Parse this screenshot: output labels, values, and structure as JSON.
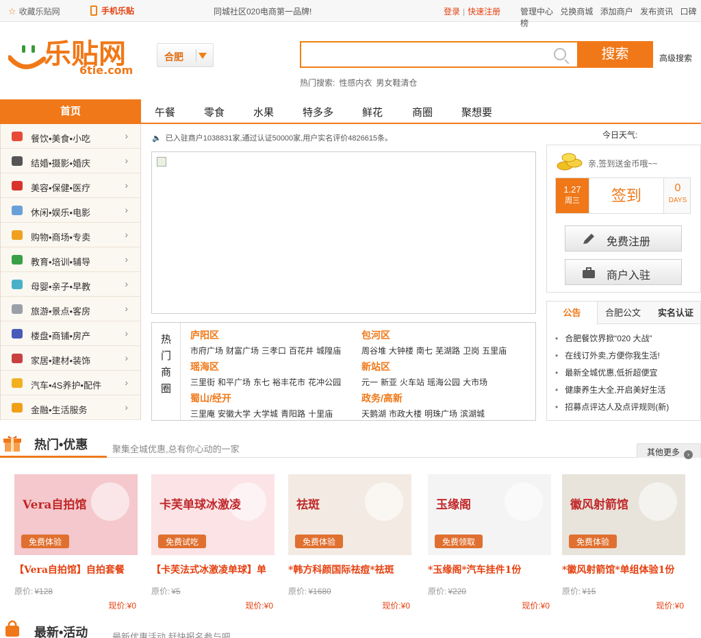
{
  "topbar": {
    "favorite": "收藏乐贴网",
    "mobile": "手机乐贴",
    "slogan": "同城社区020电商第一品牌!",
    "login": "登录",
    "register": "快速注册",
    "links": [
      "管理中心",
      "兑换商城",
      "添加商户",
      "发布资讯",
      "口碑榜"
    ]
  },
  "logo": {
    "text": "乐贴网",
    "domain": "6tie.com"
  },
  "city": "合肥",
  "search": {
    "button": "搜索",
    "advanced": "高级搜索",
    "hot_label": "热门搜索:",
    "hot_terms": [
      "性感内衣",
      "男女鞋清仓"
    ]
  },
  "nav": {
    "home": "首页",
    "items": [
      "午餐",
      "零食",
      "水果",
      "特多多",
      "鲜花",
      "商圈",
      "聚想要"
    ]
  },
  "categories": [
    {
      "label": "餐饮•美食•小吃",
      "icon": "food-icon",
      "color": "#e84a3a"
    },
    {
      "label": "结婚•摄影•婚庆",
      "icon": "camera-icon",
      "color": "#555555"
    },
    {
      "label": "美容•保健•医疗",
      "icon": "beauty-icon",
      "color": "#d8342c"
    },
    {
      "label": "休闲•娱乐•电影",
      "icon": "leisure-icon",
      "color": "#6aa0d8"
    },
    {
      "label": "购物•商场•专卖",
      "icon": "cart-icon",
      "color": "#f0a020"
    },
    {
      "label": "教育•培训•辅导",
      "icon": "book-icon",
      "color": "#3aa048"
    },
    {
      "label": "母婴•亲子•早教",
      "icon": "baby-icon",
      "color": "#4ab0c8"
    },
    {
      "label": "旅游•景点•客房",
      "icon": "plane-icon",
      "color": "#9aa0a8"
    },
    {
      "label": "楼盘•商铺•房产",
      "icon": "building-icon",
      "color": "#4a5ab8"
    },
    {
      "label": "家居•建材•装饰",
      "icon": "tools-icon",
      "color": "#c84040"
    },
    {
      "label": "汽车•4S养护•配件",
      "icon": "car-icon",
      "color": "#f0b020"
    },
    {
      "label": "金融•生活服务",
      "icon": "finance-icon",
      "color": "#f0a018"
    }
  ],
  "notice": "已入驻商户1038831家,通过认证50000家,用户实名评价4826615条。",
  "business": {
    "side": [
      "热",
      "门",
      "商",
      "圈"
    ],
    "groups": [
      {
        "title": "庐阳区",
        "areas": [
          "市府广场",
          "财富广场",
          "三孝口",
          "百花井",
          "城隍庙"
        ]
      },
      {
        "title": "包河区",
        "areas": [
          "周谷堆",
          "大钟楼",
          "南七",
          "芜湖路",
          "卫岗",
          "五里庙"
        ]
      },
      {
        "title": "瑶海区",
        "areas": [
          "三里街",
          "和平广场",
          "东七",
          "裕丰花市",
          "花冲公园"
        ]
      },
      {
        "title": "新站区",
        "areas": [
          "元一",
          "新亚",
          "火车站",
          "瑶海公园",
          "大市场"
        ]
      },
      {
        "title": "蜀山/经开",
        "areas": [
          "三里庵",
          "安徽大学",
          "大学城",
          "青阳路",
          "十里庙"
        ]
      },
      {
        "title": "政务/高新",
        "areas": [
          "天鹅湖",
          "市政大楼",
          "明珠广场",
          "滨湖城"
        ]
      }
    ]
  },
  "weather": "今日天气:",
  "signin": {
    "tip": "亲,签到送金币哦~~",
    "date": "1.27",
    "weekday": "周三",
    "button": "签到",
    "days": "0",
    "days_label": "DAYS"
  },
  "register_button": "免费注册",
  "merchant_button": "商户入驻",
  "notes": {
    "tabs": [
      "公告",
      "合肥公文",
      "实名认证"
    ],
    "items": [
      "合肥餐饮界掀“020 大战”",
      "在线订外卖,方便你我生活!",
      "最新全城优惠,低折超便宜",
      "健康养生大全,开启美好生活",
      "招募点评达人及点评规则(新)"
    ]
  },
  "hot": {
    "title": "热门•优惠",
    "subtitle": "聚集全城优惠,总有你心动的一家",
    "more": "其他更多"
  },
  "deals": [
    {
      "name": "【Vera自拍馆】自拍套餐",
      "orig_label": "原价:",
      "orig": "¥128",
      "now": "现价:¥0",
      "img_text": "Vera自拍馆",
      "img_sub": "免费体验",
      "color": "#f4c8cc"
    },
    {
      "name": "【卡芙法式冰激凌单球】单",
      "orig_label": "原价:",
      "orig": "¥5",
      "now": "现价:¥0",
      "img_text": "卡芙单球冰激凌",
      "img_sub": "免费试吃",
      "color": "#fbe3e6"
    },
    {
      "name": "*韩方科颜国际祛痘*祛斑",
      "orig_label": "原价:",
      "orig": "¥1680",
      "now": "现价:¥0",
      "img_text": "祛斑",
      "img_sub": "免费体验",
      "color": "#f3ebe3"
    },
    {
      "name": "*玉缘阁*汽车挂件1份",
      "orig_label": "原价:",
      "orig": "¥220",
      "now": "现价:¥0",
      "img_text": "玉缘阁",
      "img_sub": "免费领取",
      "color": "#f4f4f4"
    },
    {
      "name": "*徽风射箭馆*单组体验1份",
      "orig_label": "原价:",
      "orig": "¥15",
      "now": "现价:¥0",
      "img_text": "徽风射箭馆",
      "img_sub": "免费体验",
      "color": "#e8e4dc"
    }
  ],
  "latest": {
    "title": "最新•活动",
    "subtitle": "最新优惠活动,赶快报名参与吧"
  }
}
